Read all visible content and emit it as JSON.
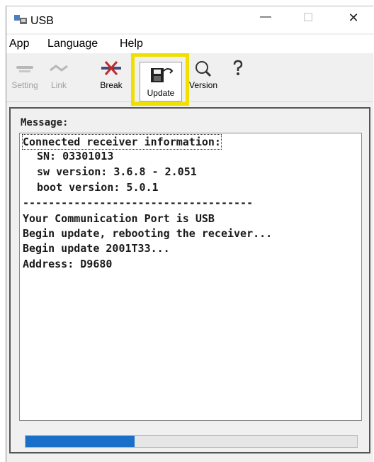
{
  "window": {
    "title": "USB",
    "minimize": "—",
    "maximize": "☐",
    "close": "✕"
  },
  "menu": [
    "App",
    "Language",
    "Help"
  ],
  "toolbar": {
    "setting": "Setting",
    "link": "Link",
    "break": "Break",
    "update": "Update",
    "version": "Version"
  },
  "message": {
    "label": "Message:",
    "lines": [
      "Connected receiver information:",
      "SN: 03301013",
      "sw version: 3.6.8 - 2.051",
      "boot version: 5.0.1",
      "------------------------------------",
      "Your Communication Port is USB",
      "Begin update, rebooting the receiver...",
      "Begin update 2001T33...",
      "Address: D9680"
    ]
  },
  "progress": {
    "fraction": 0.33
  },
  "colors": {
    "highlight": "#f0e000",
    "progress": "#1a6fc8"
  }
}
